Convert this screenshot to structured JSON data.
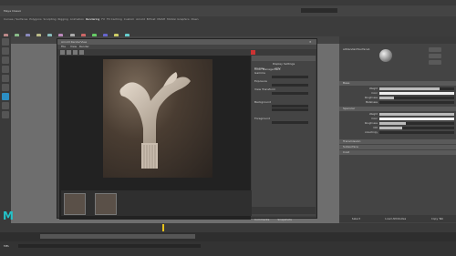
{
  "menubar": {
    "items": [
      "File",
      "Edit",
      "Create",
      "Select",
      "Modify",
      "Display",
      "Windows",
      "Mesh",
      "Edit Mesh",
      "Mesh Tools",
      "Mesh Display",
      "Curves",
      "Surfaces",
      "Deform",
      "UV",
      "Generate",
      "Cache",
      "Arnold",
      "Help"
    ]
  },
  "status": {
    "workspace": "Maya Classic"
  },
  "shelf": {
    "tabs": [
      "Curves / Surfaces",
      "Polygons",
      "Sculpting",
      "Rigging",
      "Animation",
      "Rendering",
      "FX",
      "FX Caching",
      "Custom",
      "Arnold",
      "Bifrost",
      "MASH",
      "Motion Graphics",
      "XGen"
    ]
  },
  "render_window": {
    "title": "Arnold RenderView",
    "menu": [
      "File",
      "View",
      "Render"
    ],
    "side_tabs": [
      "Display",
      "AOV"
    ],
    "side_header": "Display Settings",
    "fields": [
      "Color Management",
      "Gamma",
      "Exposure",
      "View Transform"
    ],
    "section_bg": "Background",
    "section_fg": "Foreground",
    "bottom_tabs": [
      "Comments",
      "Snapshots"
    ]
  },
  "attribute_editor": {
    "node_name": "aiStandardSurface1",
    "sections": [
      "Base",
      "Specular",
      "Transmission",
      "Subsurface",
      "Coat"
    ],
    "rows": [
      {
        "label": "Weight",
        "value": 0.8
      },
      {
        "label": "Color",
        "value": 0.9
      },
      {
        "label": "Roughness",
        "value": 0.2
      },
      {
        "label": "Metalness",
        "value": 0.0
      },
      {
        "label": "Weight",
        "value": 1.0
      },
      {
        "label": "Color",
        "value": 0.95
      },
      {
        "label": "Roughness",
        "value": 0.35
      },
      {
        "label": "IOR",
        "value": 0.3
      },
      {
        "label": "Anisotropy",
        "value": 0.0
      }
    ],
    "buttons": [
      "Select",
      "Load Attributes",
      "Copy Tab"
    ]
  },
  "command": {
    "lang": "MEL"
  },
  "colors": {
    "maya_logo": "#23c2c8",
    "accent": "#e7c21a"
  }
}
